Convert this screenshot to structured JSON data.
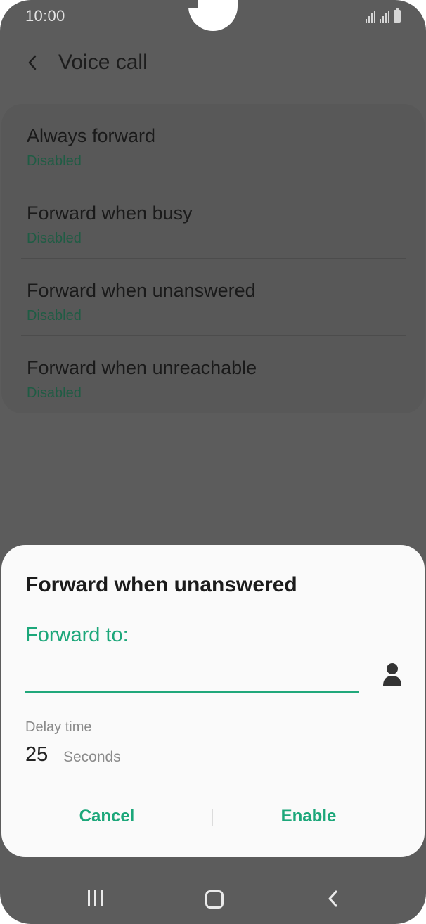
{
  "status_bar": {
    "time": "10:00"
  },
  "header": {
    "title": "Voice call",
    "back_icon": "chevron-left-icon"
  },
  "forwarding_options": [
    {
      "label": "Always forward",
      "status": "Disabled"
    },
    {
      "label": "Forward when busy",
      "status": "Disabled"
    },
    {
      "label": "Forward when unanswered",
      "status": "Disabled"
    },
    {
      "label": "Forward when unreachable",
      "status": "Disabled"
    }
  ],
  "dialog": {
    "title": "Forward when unanswered",
    "forward_to_label": "Forward to:",
    "forward_to_value": "",
    "contact_icon": "person-icon",
    "delay_label": "Delay time",
    "delay_value": "25",
    "delay_unit": "Seconds",
    "cancel_label": "Cancel",
    "enable_label": "Enable"
  },
  "colors": {
    "accent": "#1ca77a",
    "status_disabled": "#1f5c44"
  },
  "nav_bar": {
    "recent_icon": "recent-apps-icon",
    "home_icon": "home-icon",
    "back_icon": "back-icon"
  }
}
